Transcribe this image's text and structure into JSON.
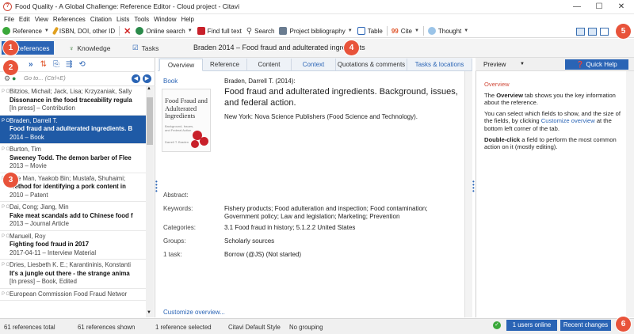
{
  "window": {
    "title": "Food Quality - A Global Challenge: Reference Editor - Cloud project - Citavi",
    "app_icon": "citavi-logo-icon",
    "minimize": "—",
    "maximize": "☐",
    "close": "✕"
  },
  "menu": [
    "File",
    "Edit",
    "View",
    "References",
    "Citation",
    "Lists",
    "Tools",
    "Window",
    "Help"
  ],
  "toolbar": {
    "reference": "Reference",
    "isbn": "ISBN, DOI, other ID",
    "online_search": "Online search",
    "find_full_text": "Find full text",
    "search": "Search",
    "project_bibliography": "Project bibliography",
    "table": "Table",
    "cite": "Cite",
    "thought": "Thought"
  },
  "nav": {
    "references": "References",
    "knowledge": "Knowledge",
    "tasks": "Tasks",
    "current_reference": "Braden 2014 – Food fraud and adulterated ingredients"
  },
  "badges": [
    "1",
    "2",
    "3",
    "4",
    "5",
    "6"
  ],
  "search": {
    "placeholder": "Go to... (Ctrl+E)"
  },
  "references": [
    {
      "author": "Bitzios, Michail; Jack, Lisa; Krzyzaniak, Sally",
      "title": "Dissonance in the food traceability regula",
      "meta": "[In press] – Contribution",
      "selected": false
    },
    {
      "author": "Braden, Darrell T.",
      "title": "Food fraud and adulterated ingredients. B",
      "meta": "2014 – Book",
      "selected": true
    },
    {
      "author": "Burton, Tim",
      "title": "Sweeney Todd. The demon barber of Flee",
      "meta": "2013 – Movie",
      "selected": false
    },
    {
      "author": "Che Man, Yaakob Bin; Mustafa, Shuhaimi;",
      "title": "Method for identifying a pork content in",
      "meta": "2010 – Patent",
      "selected": false
    },
    {
      "author": "Dai, Cong; Jiang, Min",
      "title": "Fake meat scandals add to Chinese food f",
      "meta": "2013 – Journal Article",
      "selected": false
    },
    {
      "author": "Manuell, Roy",
      "title": "Fighting food fraud in 2017",
      "meta": "2017-04-11 – Interview Material",
      "selected": false
    },
    {
      "author": "Dries, Liesbeth K. E.; Karantininis, Konstanti",
      "title": "It's a jungle out there - the strange anima",
      "meta": "[In press] – Book, Edited",
      "selected": false
    },
    {
      "author": "European Commission Food Fraud Networ",
      "title": "",
      "meta": "",
      "selected": false
    }
  ],
  "tabs": [
    "Overview",
    "Reference",
    "Content",
    "Context",
    "Quotations & comments",
    "Tasks & locations"
  ],
  "overview": {
    "type": "Book",
    "author_line": "Braden, Darrell T. (2014):",
    "title": "Food fraud and adulterated ingredients. Background, issues, and federal action.",
    "publisher": "New York: Nova Science Publishers (Food Science and Technology).",
    "cover_title": "Food Fraud and Adulterated Ingredients",
    "cover_sub": "Background, Issues, and Federal Action",
    "cover_author": "Darrell T. Braden",
    "fields": [
      {
        "label": "Abstract:",
        "value": ""
      },
      {
        "label": "Keywords:",
        "value": "Fishery products; Food adulteration and inspection; Food contamination; Government policy; Law and legislation; Marketing; Prevention"
      },
      {
        "label": "Categories:",
        "value": "3.1 Food fraud in history; 5.1.2.2 United States"
      },
      {
        "label": "Groups:",
        "value": "Scholarly sources"
      },
      {
        "label": "1 task:",
        "value": "Borrow (@JS) (Not started)"
      }
    ],
    "customize": "Customize overview..."
  },
  "preview": {
    "label": "Preview",
    "quick_help": "Quick Help",
    "heading": "Overview",
    "p1_pre": "The ",
    "p1_bold": "Overview",
    "p1_post": " tab shows you the key information about the reference.",
    "p2_pre": "You can select which fields to show, and the size of the fields, by clicking ",
    "p2_link": "Customize overview",
    "p2_post": " at the bottom left corner of the tab.",
    "p3_bold": "Double-click",
    "p3_post": " a field to perform the most common action on it (mostly editing)."
  },
  "status": {
    "total": "61 references total",
    "shown": "61 references shown",
    "selected": "1 reference selected",
    "style": "Citavi Default Style",
    "grouping": "No grouping",
    "online": "1 users online",
    "recent": "Recent changes"
  },
  "colors": {
    "accent": "#2a64b5",
    "badge": "#e8533a",
    "selection": "#1f5aa6"
  }
}
